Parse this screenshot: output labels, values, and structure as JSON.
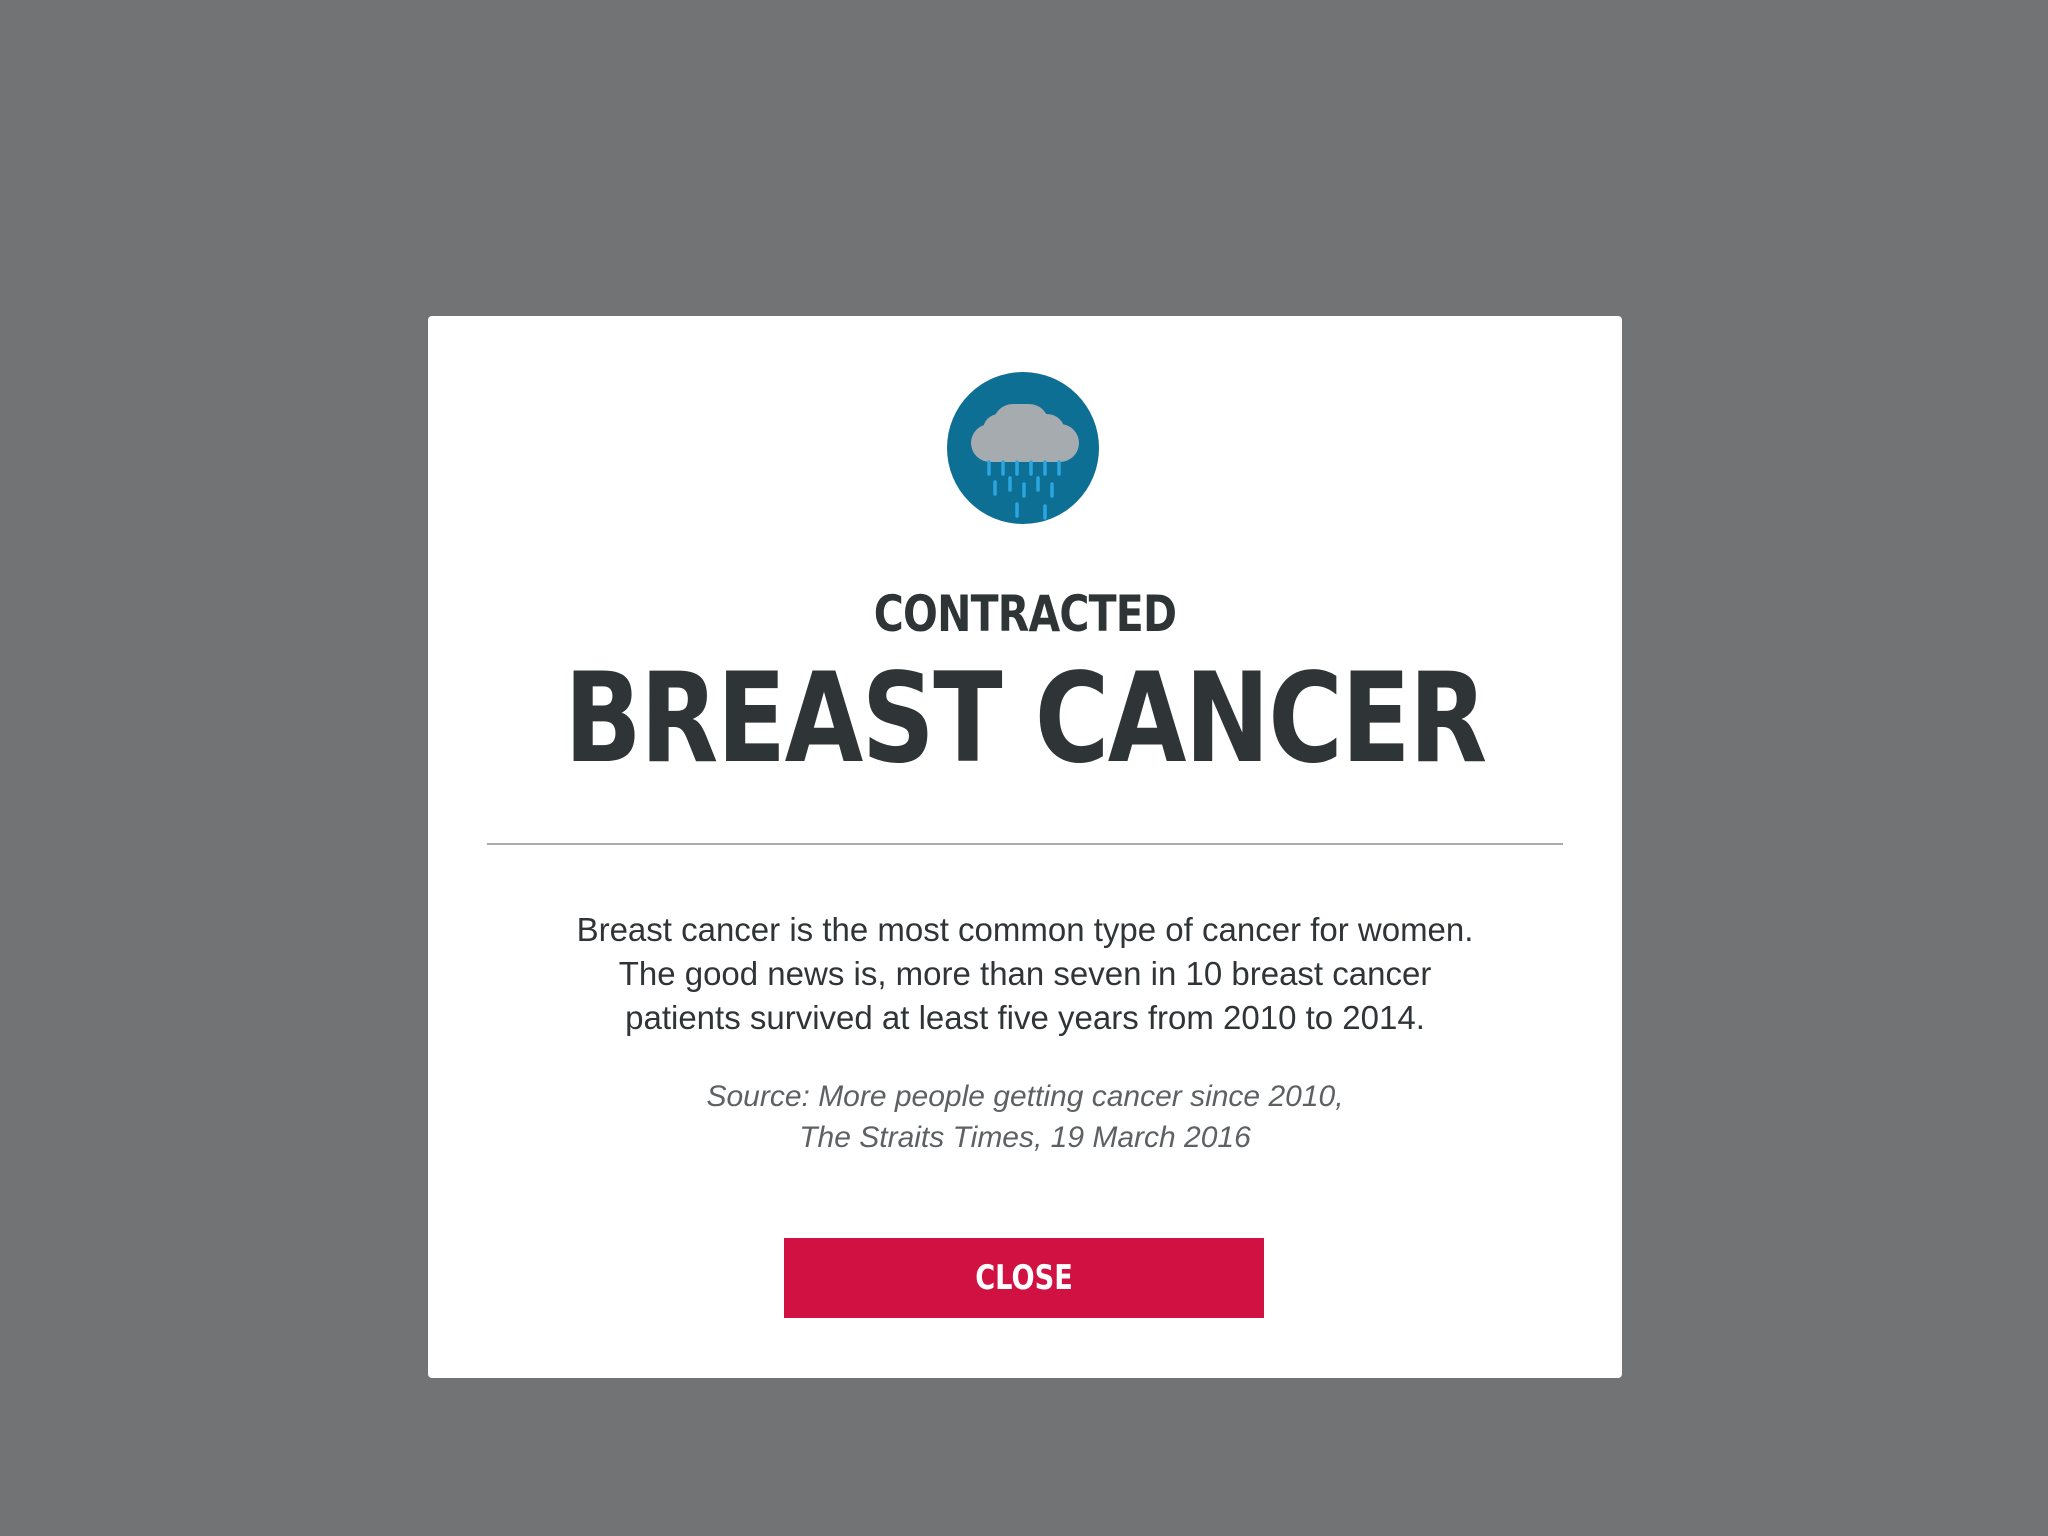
{
  "modal": {
    "icon": "rain-cloud-icon",
    "kicker": "CONTRACTED",
    "headline": "BREAST CANCER",
    "body_lines": [
      "Breast cancer is the most common type of cancer for women.",
      "The good news is, more than seven in 10 breast cancer",
      "patients survived at least five years from 2010 to 2014."
    ],
    "source_lines": [
      "Source: More people getting cancer since 2010,",
      "The Straits Times, 19 March 2016"
    ],
    "close_label": "CLOSE"
  },
  "colors": {
    "backdrop": "#727375",
    "icon_circle": "#0e6f94",
    "cloud": "#a5abaf",
    "rain": "#2ca6e0",
    "heading_text": "#2f3537",
    "close_button": "#d01142"
  }
}
